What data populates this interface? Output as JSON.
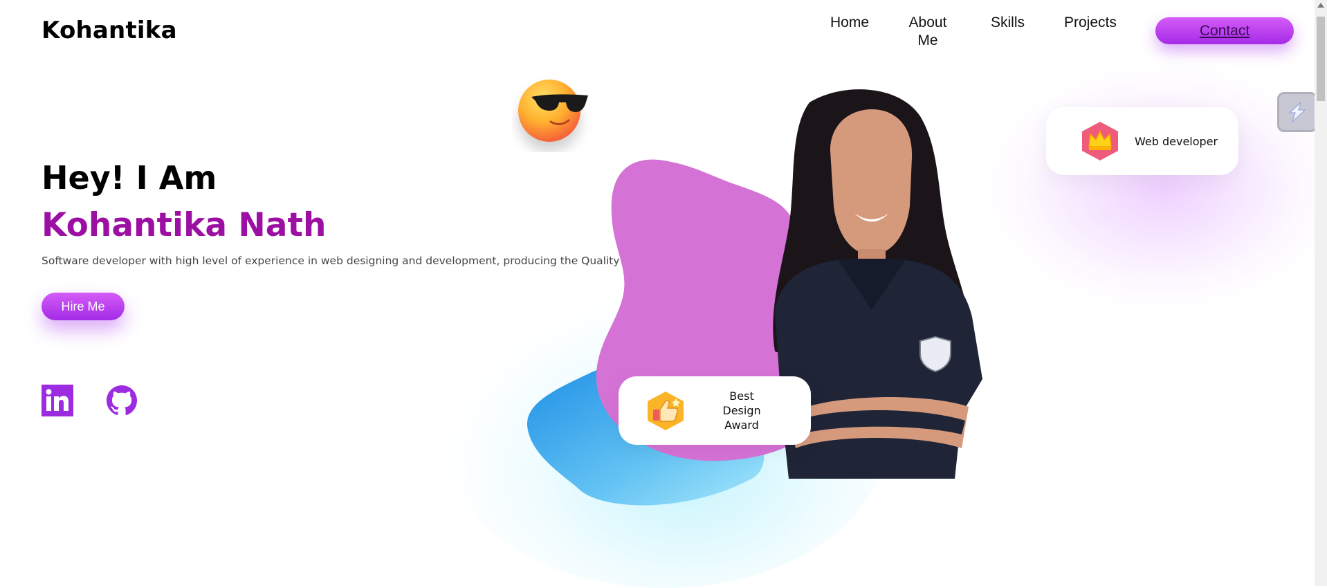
{
  "header": {
    "logo": "Kohantika",
    "nav": [
      "Home",
      "About Me",
      "Skills",
      "Projects"
    ],
    "contact_label": "Contact"
  },
  "hero": {
    "greeting": "Hey! I Am",
    "name": "Kohantika Nath",
    "tagline": "Software developer with high level of experience in web designing and development, producing the Quality work.",
    "hire_label": "Hire Me"
  },
  "social": [
    "linkedin-icon",
    "github-icon"
  ],
  "cards": {
    "web": "Web developer",
    "award": "Best Design Award"
  },
  "colors": {
    "accent": "#a42be6",
    "name": "#9c0fa3",
    "blob": "#d572d6",
    "blue_blob": "#3ba5ec"
  }
}
